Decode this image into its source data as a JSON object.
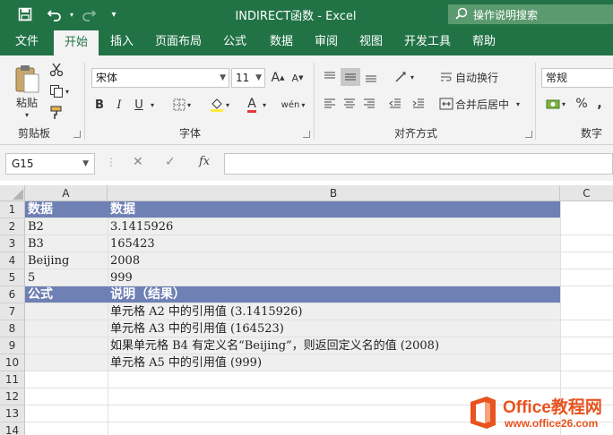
{
  "window": {
    "title": "INDIRECT函数  -  Excel",
    "search_placeholder": "操作说明搜索"
  },
  "quick_access": {
    "save_icon": "save-icon",
    "undo_icon": "undo-icon",
    "redo_icon": "redo-icon",
    "customize_icon": "customize-icon"
  },
  "tabs": [
    {
      "label": "文件"
    },
    {
      "label": "开始"
    },
    {
      "label": "插入"
    },
    {
      "label": "页面布局"
    },
    {
      "label": "公式"
    },
    {
      "label": "数据"
    },
    {
      "label": "审阅"
    },
    {
      "label": "视图"
    },
    {
      "label": "开发工具"
    },
    {
      "label": "帮助"
    }
  ],
  "active_tab": "开始",
  "ribbon": {
    "clipboard": {
      "paste_label": "粘贴",
      "group_label": "剪贴板"
    },
    "font": {
      "font_name": "宋体",
      "font_size": "11",
      "group_label": "字体",
      "bold": "B",
      "italic": "I",
      "underline": "U",
      "grow": "A",
      "shrink": "A",
      "font_color": "A",
      "phonetic": "wén"
    },
    "alignment": {
      "wrap_label": "自动换行",
      "merge_label": "合并后居中",
      "group_label": "对齐方式"
    },
    "number": {
      "format": "常规",
      "group_label": "数字",
      "percent": "%",
      "comma": ","
    }
  },
  "formula_bar": {
    "name_box": "G15",
    "fx_label": "fx",
    "content": ""
  },
  "columns": [
    "A",
    "B",
    "C"
  ],
  "rows": [
    {
      "num": "1",
      "a": "数据",
      "b": "数据",
      "header": true
    },
    {
      "num": "2",
      "a": "B2",
      "b": "3.1415926"
    },
    {
      "num": "3",
      "a": "B3",
      "b": "165423"
    },
    {
      "num": "4",
      "a": "Beijing",
      "b": "2008"
    },
    {
      "num": "5",
      "a": "5",
      "b": "999"
    },
    {
      "num": "6",
      "a": "公式",
      "b": "说明（结果）",
      "header": true
    },
    {
      "num": "7",
      "a": "",
      "b": "单元格 A2 中的引用值 (3.1415926)"
    },
    {
      "num": "8",
      "a": "",
      "b": "单元格 A3 中的引用值 (164523)"
    },
    {
      "num": "9",
      "a": "",
      "b": "如果单元格 B4 有定义名“Beijing”，则返回定义名的值 (2008)"
    },
    {
      "num": "10",
      "a": "",
      "b": "单元格 A5 中的引用值 (999)"
    },
    {
      "num": "11",
      "a": "",
      "b": ""
    },
    {
      "num": "12",
      "a": "",
      "b": ""
    },
    {
      "num": "13",
      "a": "",
      "b": ""
    },
    {
      "num": "14",
      "a": "",
      "b": ""
    }
  ],
  "watermark": {
    "brand": "Office教程网",
    "url": "www.office26.com"
  },
  "colors": {
    "excel_green": "#217346",
    "header_fill": "#6e80b4",
    "watermark_orange": "#e8531f"
  }
}
